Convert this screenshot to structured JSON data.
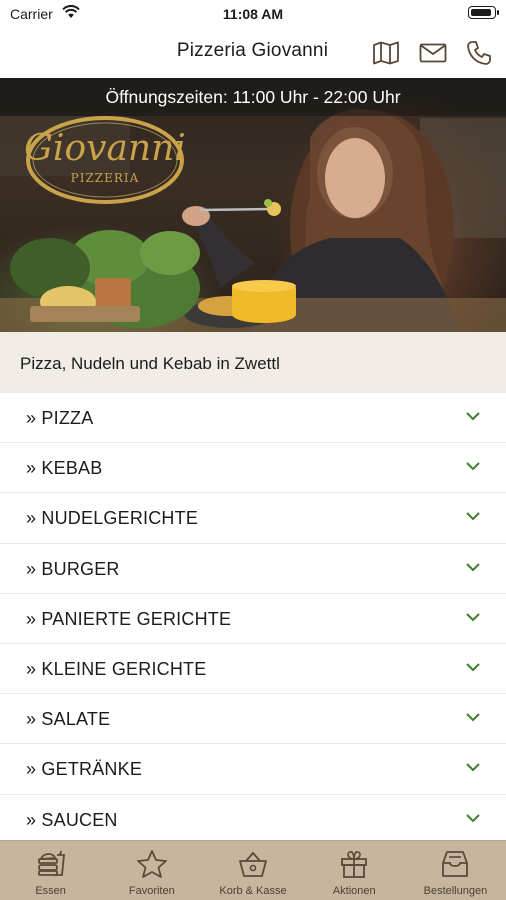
{
  "status_bar": {
    "carrier": "Carrier",
    "time": "11:08 AM"
  },
  "nav": {
    "title": "Pizzeria Giovanni",
    "icons": [
      "map-icon",
      "mail-icon",
      "phone-icon"
    ]
  },
  "hero": {
    "opening_hours": "Öffnungszeiten: 11:00 Uhr - 22:00 Uhr",
    "logo_text": "Giovanni",
    "logo_subtext": "PIZZERIA"
  },
  "subtitle": "Pizza, Nudeln und Kebab in Zwettl",
  "categories": [
    {
      "label": "» PIZZA"
    },
    {
      "label": "» KEBAB"
    },
    {
      "label": "» NUDELGERICHTE"
    },
    {
      "label": "» BURGER"
    },
    {
      "label": "» PANIERTE GERICHTE"
    },
    {
      "label": "» KLEINE GERICHTE"
    },
    {
      "label": "» SALATE"
    },
    {
      "label": "» GETRÄNKE"
    },
    {
      "label": "» SAUCEN"
    }
  ],
  "tabs": [
    {
      "label": "Essen",
      "icon": "food-icon"
    },
    {
      "label": "Favoriten",
      "icon": "star-icon"
    },
    {
      "label": "Korb & Kasse",
      "icon": "basket-icon"
    },
    {
      "label": "Aktionen",
      "icon": "gift-icon"
    },
    {
      "label": "Bestellungen",
      "icon": "inbox-icon"
    }
  ],
  "colors": {
    "accent": "#3f7d2c",
    "tab_bar": "#c9b59d",
    "subtitle_band": "#f1ece6",
    "logo_gold": "#c9a24a"
  }
}
